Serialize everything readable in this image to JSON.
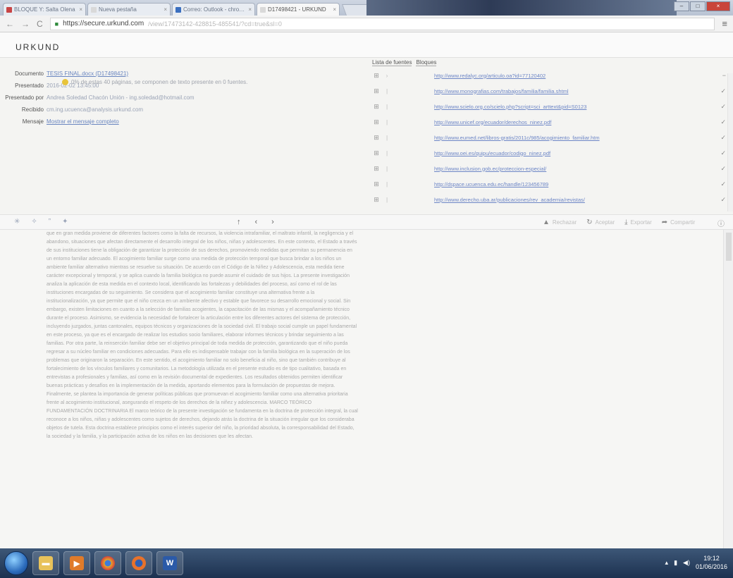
{
  "browser": {
    "tabs": [
      {
        "label": "BLOQUE Y: Salta Olena",
        "favicon": "red"
      },
      {
        "label": "Nueva pestaña",
        "favicon": "doc"
      },
      {
        "label": "Correo: Outlook - chrome",
        "favicon": "blue"
      },
      {
        "label": "D17498421 - URKUND",
        "favicon": "doc",
        "active": true
      }
    ],
    "url_host": "https://secure.urkund.com",
    "url_rest": "/view/17473142-428815-485541/?cd=true&sl=0"
  },
  "app": {
    "logo": "URKUND"
  },
  "doc_info": {
    "documento_label": "Documento",
    "documento_value": "TESIS FINAL.docx (D17498421)",
    "presentado_label": "Presentado",
    "presentado_value": "2016-02-02 13:45:00",
    "presentado_por_label": "Presentado por",
    "presentado_por_value": "Andrea Soledad Chacón Unión - ing.soledad@hotmail.com",
    "recibido_label": "Recibido",
    "recibido_value": "cm.ing.ucuenca@analysis.urkund.com",
    "mensaje_label": "Mensaje",
    "mensaje_value": "Mostrar el mensaje completo",
    "note": "0% de estas 40 páginas, se componen de texto presente en 0 fuentes."
  },
  "sources": {
    "tab_list": "Lista de fuentes",
    "tab_blocks": "Bloques",
    "items": [
      {
        "url": "http://www.redalyc.org/articulo.oa?id=77120402",
        "marker": "›"
      },
      {
        "url": "http://www.monografias.com/trabajos/familia/familia.shtml",
        "marker": "|"
      },
      {
        "url": "http://www.scielo.org.co/scielo.php?script=sci_arttext&pid=S0123",
        "marker": "|"
      },
      {
        "url": "http://www.unicef.org/ecuador/derechos_ninez.pdf",
        "marker": "|"
      },
      {
        "url": "http://www.eumed.net/libros-gratis/2011c/985/acogimiento_familiar.htm",
        "marker": "|"
      },
      {
        "url": "http://www.oei.es/quipu/ecuador/codigo_ninez.pdf",
        "marker": "|"
      },
      {
        "url": "http://www.inclusion.gob.ec/proteccion-especial/",
        "marker": "|"
      },
      {
        "url": "http://dspace.ucuenca.edu.ec/handle/123456789",
        "marker": "|"
      },
      {
        "url": "http://www.derecho.uba.ar/publicaciones/rev_academia/revistas/",
        "marker": "|"
      }
    ]
  },
  "toolbar": {
    "reject_label": "Rechazar",
    "accept_label": "Aceptar",
    "export_label": "Exportar",
    "share_label": "Compartir"
  },
  "document_text": "que en gran medida proviene de diferentes factores como la falta de recursos, la violencia intrafamiliar, el maltrato infantil, la negligencia y el abandono, situaciones que afectan directamente el desarrollo integral de los niños, niñas y adolescentes. En este contexto, el Estado a través de sus instituciones tiene la obligación de garantizar la protección de sus derechos, promoviendo medidas que permitan su permanencia en un entorno familiar adecuado. El acogimiento familiar surge como una medida de protección temporal que busca brindar a los niños un ambiente familiar alternativo mientras se resuelve su situación. De acuerdo con el Código de la Niñez y Adolescencia, esta medida tiene carácter excepcional y temporal, y se aplica cuando la familia biológica no puede asumir el cuidado de sus hijos. La presente investigación analiza la aplicación de esta medida en el contexto local, identificando las fortalezas y debilidades del proceso, así como el rol de las instituciones encargadas de su seguimiento. Se considera que el acogimiento familiar constituye una alternativa frente a la institucionalización, ya que permite que el niño crezca en un ambiente afectivo y estable que favorece su desarrollo emocional y social. Sin embargo, existen limitaciones en cuanto a la selección de familias acogientes, la capacitación de las mismas y el acompañamiento técnico durante el proceso. Asimismo, se evidencia la necesidad de fortalecer la articulación entre los diferentes actores del sistema de protección, incluyendo juzgados, juntas cantonales, equipos técnicos y organizaciones de la sociedad civil. El trabajo social cumple un papel fundamental en este proceso, ya que es el encargado de realizar los estudios socio familiares, elaborar informes técnicos y brindar seguimiento a las familias. Por otra parte, la reinserción familiar debe ser el objetivo principal de toda medida de protección, garantizando que el niño pueda regresar a su núcleo familiar en condiciones adecuadas. Para ello es indispensable trabajar con la familia biológica en la superación de los problemas que originaron la separación. En este sentido, el acogimiento familiar no solo beneficia al niño, sino que también contribuye al fortalecimiento de los vínculos familiares y comunitarios. La metodología utilizada en el presente estudio es de tipo cualitativo, basada en entrevistas a profesionales y familias, así como en la revisión documental de expedientes. Los resultados obtenidos permiten identificar buenas prácticas y desafíos en la implementación de la medida, aportando elementos para la formulación de propuestas de mejora. Finalmente, se plantea la importancia de generar políticas públicas que promuevan el acogimiento familiar como una alternativa prioritaria frente al acogimiento institucional, asegurando el respeto de los derechos de la niñez y adolescencia. MARCO TEÓRICO FUNDAMENTACIÓN DOCTRINARIA El marco teórico de la presente investigación se fundamenta en la doctrina de protección integral, la cual reconoce a los niños, niñas y adolescentes como sujetos de derechos, dejando atrás la doctrina de la situación irregular que los consideraba objetos de tutela. Esta doctrina establece principios como el interés superior del niño, la prioridad absoluta, la corresponsabilidad del Estado, la sociedad y la familia, y la participación activa de los niños en las decisiones que les afectan.",
  "taskbar": {
    "time": "19:12",
    "date": "01/06/2016"
  }
}
